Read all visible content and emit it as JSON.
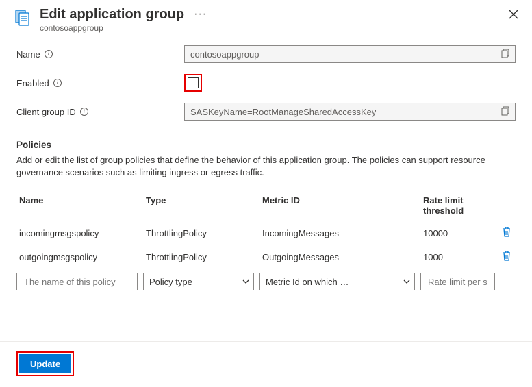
{
  "header": {
    "title": "Edit application group",
    "subtitle": "contosoappgroup"
  },
  "form": {
    "name_label": "Name",
    "name_value": "contosoappgroup",
    "enabled_label": "Enabled",
    "enabled_checked": false,
    "client_group_id_label": "Client group ID",
    "client_group_id_value": "SASKeyName=RootManageSharedAccessKey"
  },
  "policies": {
    "section_title": "Policies",
    "description": "Add or edit the list of group policies that define the behavior of this application group. The policies can support resource governance scenarios such as limiting ingress or egress traffic.",
    "columns": {
      "name": "Name",
      "type": "Type",
      "metric_id": "Metric ID",
      "threshold": "Rate limit threshold"
    },
    "rows": [
      {
        "name": "incomingmsgspolicy",
        "type": "ThrottlingPolicy",
        "metric_id": "IncomingMessages",
        "threshold": "10000"
      },
      {
        "name": "outgoingmsgspolicy",
        "type": "ThrottlingPolicy",
        "metric_id": "OutgoingMessages",
        "threshold": "1000"
      }
    ],
    "new_row": {
      "name_placeholder": "The name of this policy",
      "type_label": "Policy type",
      "metric_label": "Metric Id on which …",
      "threshold_placeholder": "Rate limit per second"
    }
  },
  "footer": {
    "update_label": "Update"
  }
}
